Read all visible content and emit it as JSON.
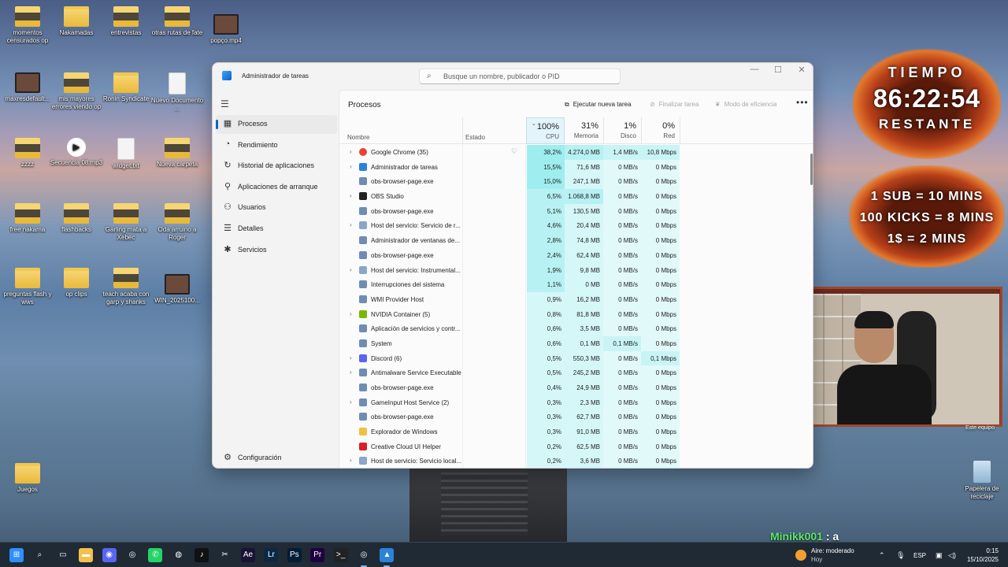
{
  "desktop": {
    "icons": [
      {
        "label": "momentos censurados op"
      },
      {
        "label": "Nakamadas"
      },
      {
        "label": "entrevistas"
      },
      {
        "label": "otras rutas de fate"
      },
      {
        "label": "popço.mp4"
      },
      {
        "label": "maxresdefault..."
      },
      {
        "label": "mis mayores errores viendo op"
      },
      {
        "label": "Ronin Syndicate"
      },
      {
        "label": "Nuevo Documento ..."
      },
      {
        "label": "zzzz"
      },
      {
        "label": "Secuencia 08.mp3"
      },
      {
        "label": "widget.txt"
      },
      {
        "label": "Nueva carpeta"
      },
      {
        "label": "free nakama"
      },
      {
        "label": "flashbacks"
      },
      {
        "label": "Garling mata a Xebec"
      },
      {
        "label": "Oda arruino a Roger"
      },
      {
        "label": "preguntas flash y wws"
      },
      {
        "label": "op clips"
      },
      {
        "label": "teach acaba con garp y shanks"
      },
      {
        "label": "WIN_2025100..."
      },
      {
        "label": "Juegos"
      },
      {
        "label": "Papelera de reciclaje"
      }
    ]
  },
  "window": {
    "title": "Administrador de tareas",
    "search_placeholder": "Busque un nombre, publicador o PID",
    "controls": {
      "minimize": "—",
      "maximize": "☐",
      "close": "✕"
    }
  },
  "sidebar": {
    "items": [
      {
        "label": "Procesos",
        "icon": "grid-icon"
      },
      {
        "label": "Rendimiento",
        "icon": "chart-icon"
      },
      {
        "label": "Historial de aplicaciones",
        "icon": "history-icon"
      },
      {
        "label": "Aplicaciones de arranque",
        "icon": "startup-icon"
      },
      {
        "label": "Usuarios",
        "icon": "users-icon"
      },
      {
        "label": "Detalles",
        "icon": "list-icon"
      },
      {
        "label": "Servicios",
        "icon": "puzzle-icon"
      }
    ],
    "settings_label": "Configuración"
  },
  "toolbar": {
    "page_title": "Procesos",
    "run_task": "Ejecutar nueva tarea",
    "end_task": "Finalizar tarea",
    "efficiency": "Modo de eficiencia",
    "more": "•••"
  },
  "table": {
    "col_name": "Nombre",
    "col_status": "Estado",
    "cpu": {
      "pct": "100%",
      "label": "CPU"
    },
    "mem": {
      "pct": "31%",
      "label": "Memoria"
    },
    "disk": {
      "pct": "1%",
      "label": "Disco"
    },
    "net": {
      "pct": "0%",
      "label": "Red"
    },
    "rows": [
      {
        "name": "Google Chrome (35)",
        "cpu": "38,2%",
        "mem": "4.274,0 MB",
        "disk": "1,4 MB/s",
        "net": "10,8 Mbps",
        "expand": true,
        "icon_color": "#e94235",
        "status": "♡"
      },
      {
        "name": "Administrador de tareas",
        "cpu": "15,5%",
        "mem": "71,6 MB",
        "disk": "0 MB/s",
        "net": "0 Mbps",
        "expand": true,
        "icon_color": "#2a82da",
        "status": ""
      },
      {
        "name": "obs-browser-page.exe",
        "cpu": "15,0%",
        "mem": "247,1 MB",
        "disk": "0 MB/s",
        "net": "0 Mbps",
        "expand": false,
        "icon_color": "#6f8db3",
        "status": ""
      },
      {
        "name": "OBS Studio",
        "cpu": "6,5%",
        "mem": "1.068,8 MB",
        "disk": "0 MB/s",
        "net": "0 Mbps",
        "expand": true,
        "icon_color": "#222222",
        "status": ""
      },
      {
        "name": "obs-browser-page.exe",
        "cpu": "5,1%",
        "mem": "130,5 MB",
        "disk": "0 MB/s",
        "net": "0 Mbps",
        "expand": false,
        "icon_color": "#6f8db3",
        "status": ""
      },
      {
        "name": "Host del servicio: Servicio de r...",
        "cpu": "4,6%",
        "mem": "20,4 MB",
        "disk": "0 MB/s",
        "net": "0 Mbps",
        "expand": true,
        "icon_color": "#8aa6c8",
        "status": ""
      },
      {
        "name": "Administrador de ventanas de...",
        "cpu": "2,8%",
        "mem": "74,8 MB",
        "disk": "0 MB/s",
        "net": "0 Mbps",
        "expand": false,
        "icon_color": "#6f8db3",
        "status": ""
      },
      {
        "name": "obs-browser-page.exe",
        "cpu": "2,4%",
        "mem": "62,4 MB",
        "disk": "0 MB/s",
        "net": "0 Mbps",
        "expand": false,
        "icon_color": "#6f8db3",
        "status": ""
      },
      {
        "name": "Host del servicio: Instrumental...",
        "cpu": "1,9%",
        "mem": "9,8 MB",
        "disk": "0 MB/s",
        "net": "0 Mbps",
        "expand": true,
        "icon_color": "#8aa6c8",
        "status": ""
      },
      {
        "name": "Interrupciones del sistema",
        "cpu": "1,1%",
        "mem": "0 MB",
        "disk": "0 MB/s",
        "net": "0 Mbps",
        "expand": false,
        "icon_color": "#6f8db3",
        "status": ""
      },
      {
        "name": "WMI Provider Host",
        "cpu": "0,9%",
        "mem": "16,2 MB",
        "disk": "0 MB/s",
        "net": "0 Mbps",
        "expand": false,
        "icon_color": "#6f8db3",
        "status": ""
      },
      {
        "name": "NVIDIA Container (5)",
        "cpu": "0,8%",
        "mem": "81,8 MB",
        "disk": "0 MB/s",
        "net": "0 Mbps",
        "expand": true,
        "icon_color": "#76b900",
        "status": ""
      },
      {
        "name": "Aplicación de servicios y contr...",
        "cpu": "0,6%",
        "mem": "3,5 MB",
        "disk": "0 MB/s",
        "net": "0 Mbps",
        "expand": false,
        "icon_color": "#6f8db3",
        "status": ""
      },
      {
        "name": "System",
        "cpu": "0,6%",
        "mem": "0,1 MB",
        "disk": "0,1 MB/s",
        "net": "0 Mbps",
        "expand": false,
        "icon_color": "#6f8db3",
        "status": ""
      },
      {
        "name": "Discord (6)",
        "cpu": "0,5%",
        "mem": "550,3 MB",
        "disk": "0 MB/s",
        "net": "0,1 Mbps",
        "expand": true,
        "icon_color": "#5865f2",
        "status": ""
      },
      {
        "name": "Antimalware Service Executable",
        "cpu": "0,5%",
        "mem": "245,2 MB",
        "disk": "0 MB/s",
        "net": "0 Mbps",
        "expand": true,
        "icon_color": "#6f8db3",
        "status": ""
      },
      {
        "name": "obs-browser-page.exe",
        "cpu": "0,4%",
        "mem": "24,9 MB",
        "disk": "0 MB/s",
        "net": "0 Mbps",
        "expand": false,
        "icon_color": "#6f8db3",
        "status": ""
      },
      {
        "name": "GameInput Host Service (2)",
        "cpu": "0,3%",
        "mem": "2,3 MB",
        "disk": "0 MB/s",
        "net": "0 Mbps",
        "expand": true,
        "icon_color": "#6f8db3",
        "status": ""
      },
      {
        "name": "obs-browser-page.exe",
        "cpu": "0,3%",
        "mem": "62,7 MB",
        "disk": "0 MB/s",
        "net": "0 Mbps",
        "expand": false,
        "icon_color": "#6f8db3",
        "status": ""
      },
      {
        "name": "Explorador de Windows",
        "cpu": "0,3%",
        "mem": "91,0 MB",
        "disk": "0 MB/s",
        "net": "0 Mbps",
        "expand": false,
        "icon_color": "#f0c040",
        "status": ""
      },
      {
        "name": "Creative Cloud UI Helper",
        "cpu": "0,2%",
        "mem": "62,5 MB",
        "disk": "0 MB/s",
        "net": "0 Mbps",
        "expand": false,
        "icon_color": "#da1f26",
        "status": ""
      },
      {
        "name": "Host de servicio: Servicio local...",
        "cpu": "0,2%",
        "mem": "3,6 MB",
        "disk": "0 MB/s",
        "net": "0 Mbps",
        "expand": true,
        "icon_color": "#8aa6c8",
        "status": ""
      }
    ]
  },
  "overlay": {
    "timer_title": "TIEMPO",
    "timer_value": "86:22:54",
    "timer_sub": "RESTANTE",
    "rule1": "1 SUB = 10 MINS",
    "rule2": "100 KICKS = 8 MINS",
    "rule3": "1$ = 2 MINS",
    "cam_label": "Este equipo"
  },
  "chat": {
    "user": "Minikk001",
    "sep": ":",
    "msg": "a"
  },
  "taskbar": {
    "weather_line1": "Aire: moderado",
    "weather_line2": "Hoy",
    "lang": "ESP",
    "time": "0:15",
    "date": "15/10/2025",
    "apps": [
      "start-icon",
      "search-icon",
      "taskview-icon",
      "explorer-icon",
      "discord-icon",
      "chrome-icon",
      "whatsapp-icon",
      "obs-icon",
      "tiktok-icon",
      "capcut-icon",
      "after-effects-icon",
      "lightroom-icon",
      "photoshop-icon",
      "premiere-icon",
      "terminal-icon",
      "chrome-alt-icon",
      "taskmanager-icon"
    ],
    "app_labels": [
      "⊞",
      "⌕",
      "▭",
      "▬",
      "◉",
      "◎",
      "✆",
      "◍",
      "♪",
      "✂",
      "Ae",
      "Lr",
      "Ps",
      "Pr",
      ">_",
      "◎",
      "▲"
    ],
    "app_colors": [
      "#2f8fff",
      "#1f2a35",
      "#1f2a35",
      "#f2c14e",
      "#5865f2",
      "#1f2a35",
      "#25d366",
      "#1f2a35",
      "#111111",
      "#1f2a35",
      "#1b1237",
      "#0b2945",
      "#001e36",
      "#1f0040",
      "#222222",
      "#1f2a35",
      "#2a82da"
    ]
  }
}
